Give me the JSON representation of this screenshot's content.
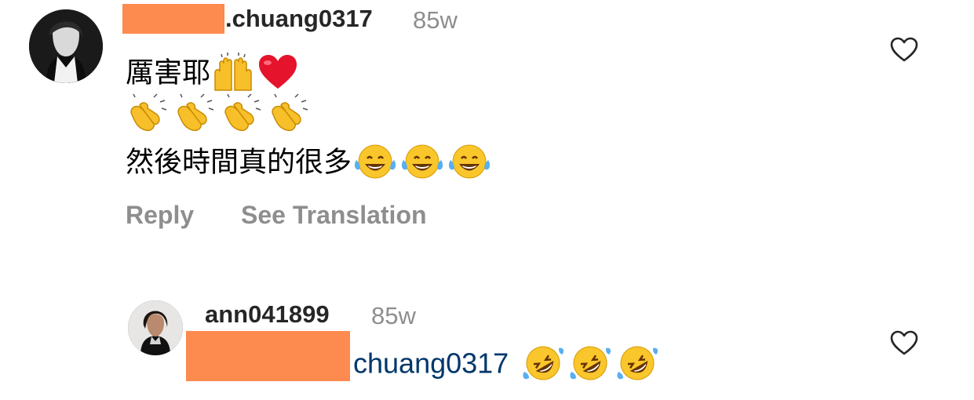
{
  "comments": [
    {
      "username": ".chuang0317",
      "timestamp": "85w",
      "line1_text": "厲害耶",
      "line3_text": "然後時間真的很多",
      "reply_label": "Reply",
      "translation_label": "See Translation",
      "icons": [
        "raising-hands-emoji",
        "red-heart-emoji",
        "clapping-hands-emoji",
        "face-with-tears-of-joy-emoji",
        "heart-outline-icon"
      ]
    },
    {
      "username": "ann041899",
      "timestamp": "85w",
      "mention": "chuang0317",
      "icons": [
        "rolling-on-floor-laughing-emoji",
        "heart-outline-icon"
      ]
    }
  ],
  "colors": {
    "redaction": "#fd8a4f",
    "username": "#262626",
    "muted": "#8e8e8e",
    "mention": "#00376b"
  }
}
